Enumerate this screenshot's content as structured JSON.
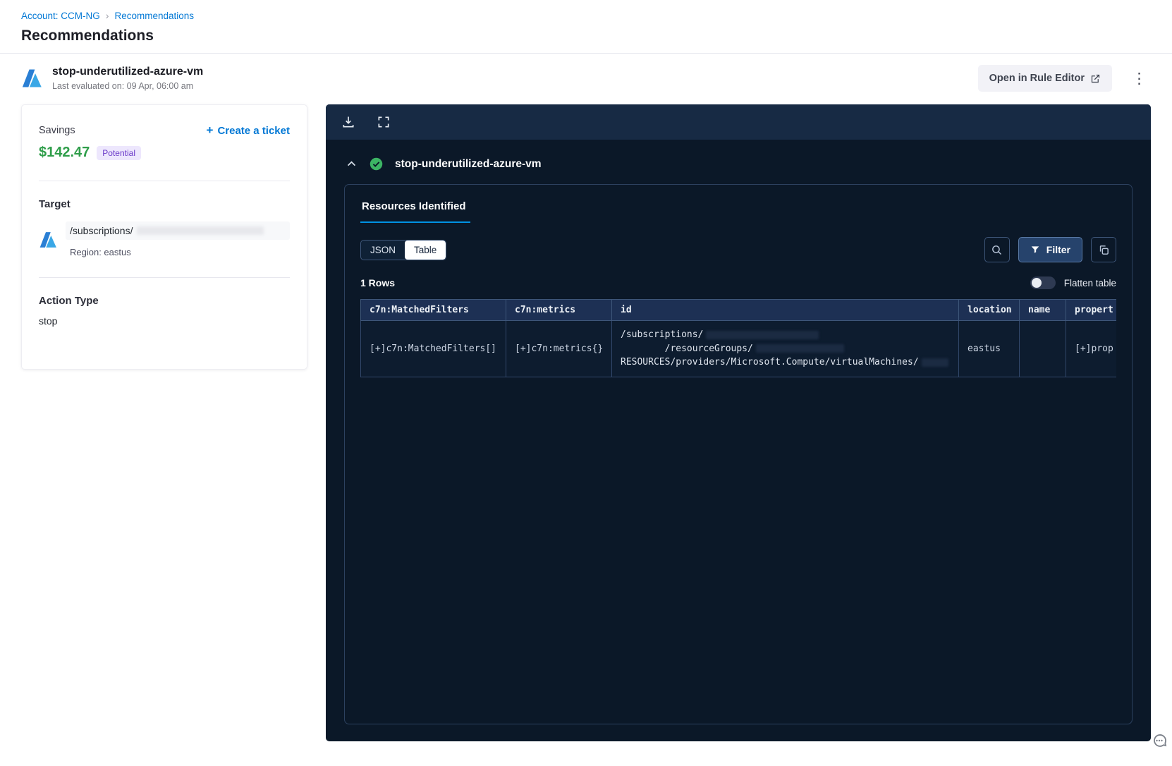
{
  "icons": {
    "plus": "+",
    "more": "⋮",
    "breadcrumb_sep": "›"
  },
  "accent": {
    "link_blue": "#0278d5",
    "green": "#2f9e4a",
    "tab_underline": "#0092e4"
  },
  "breadcrumb": {
    "account_link": "Account: CCM-NG",
    "recommendations_link": "Recommendations"
  },
  "page": {
    "title": "Recommendations"
  },
  "rule_header": {
    "title": "stop-underutilized-azure-vm",
    "last_evaluated": "Last evaluated on: 09 Apr, 06:00 am",
    "open_in_rule_editor": "Open in Rule Editor"
  },
  "savings_card": {
    "savings_label": "Savings",
    "amount": "$142.47",
    "badge": "Potential",
    "create_ticket": "Create a ticket",
    "target": {
      "label": "Target",
      "path": "/subscriptions/",
      "region": "Region: eastus"
    },
    "action": {
      "label": "Action Type",
      "value": "stop"
    }
  },
  "viewer": {
    "rule_title": "stop-underutilized-azure-vm",
    "tab": "Resources Identified",
    "view_toggle": {
      "json": "JSON",
      "table": "Table"
    },
    "filter_button": "Filter",
    "rows_count": "1 Rows",
    "flatten_label": "Flatten table",
    "table": {
      "columns": [
        "c7n:MatchedFilters",
        "c7n:metrics",
        "id",
        "location",
        "name",
        "propert"
      ],
      "row": {
        "matched_filters": "[+]c7n:MatchedFilters[]",
        "metrics": "[+]c7n:metrics{}",
        "id_line1": "/subscriptions/",
        "id_line2": "        /resourceGroups/",
        "id_line3": "RESOURCES/providers/Microsoft.Compute/virtualMachines/",
        "location": "eastus",
        "name": "",
        "properties": "[+]prop"
      }
    }
  }
}
